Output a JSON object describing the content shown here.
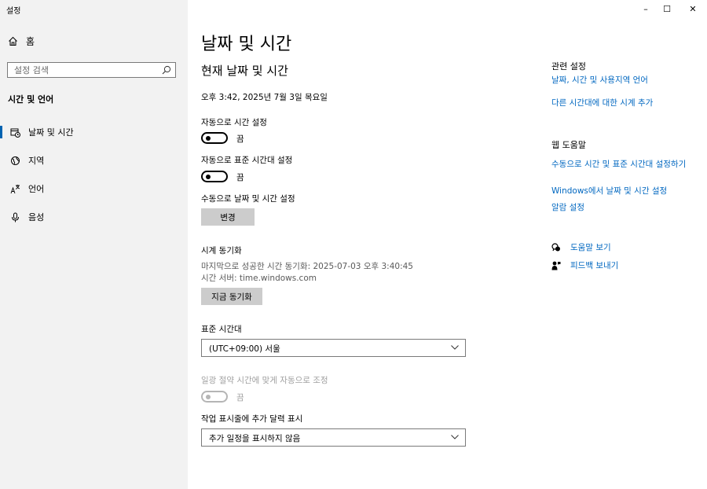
{
  "window": {
    "title": "설정",
    "minimize": "–",
    "maximize": "☐",
    "close": "✕"
  },
  "sidebar": {
    "home_label": "홈",
    "search_placeholder": "설정 검색",
    "section_title": "시간 및 언어",
    "items": [
      {
        "label": "날짜 및 시간",
        "icon": "calendar-clock-icon",
        "active": true
      },
      {
        "label": "지역",
        "icon": "globe-icon",
        "active": false
      },
      {
        "label": "언어",
        "icon": "language-icon",
        "active": false
      },
      {
        "label": "음성",
        "icon": "microphone-icon",
        "active": false
      }
    ]
  },
  "main": {
    "page_title": "날짜 및 시간",
    "sub_title": "현재 날짜 및 시간",
    "current_datetime": "오후 3:42, 2025년 7월 3일 목요일",
    "auto_time": {
      "label": "자동으로 시간 설정",
      "state": "끔"
    },
    "auto_timezone": {
      "label": "자동으로 표준 시간대 설정",
      "state": "끔"
    },
    "manual": {
      "label": "수동으로 날짜 및 시간 설정",
      "button": "변경"
    },
    "sync": {
      "title": "시계 동기화",
      "last_sync": "마지막으로 성공한 시간 동기화: 2025-07-03 오후 3:40:45",
      "server": "시간 서버: time.windows.com",
      "button": "지금 동기화"
    },
    "timezone": {
      "label": "표준 시간대",
      "value": "(UTC+09:00) 서울"
    },
    "dst": {
      "label": "일광 절약 시간에 맞게 자동으로 조정",
      "state": "끔"
    },
    "calendar": {
      "label": "작업 표시줄에 추가 달력 표시",
      "value": "추가 일정을 표시하지 않음"
    }
  },
  "right": {
    "related_title": "관련 설정",
    "related_links": [
      "날짜, 시간 및 사용지역 언어",
      "다른 시간대에 대한 시계 추가"
    ],
    "help_title": "웹 도움말",
    "help_links": [
      "수동으로 시간 및 표준 시간대 설정하기",
      "Windows에서 날짜 및 시간 설정",
      "알람 설정"
    ],
    "get_help": "도움말 보기",
    "feedback": "피드백 보내기"
  },
  "colors": {
    "accent": "#0063b1",
    "link": "#0067c0",
    "sidebar_bg": "#f2f2f2",
    "button_bg": "#cccccc"
  }
}
